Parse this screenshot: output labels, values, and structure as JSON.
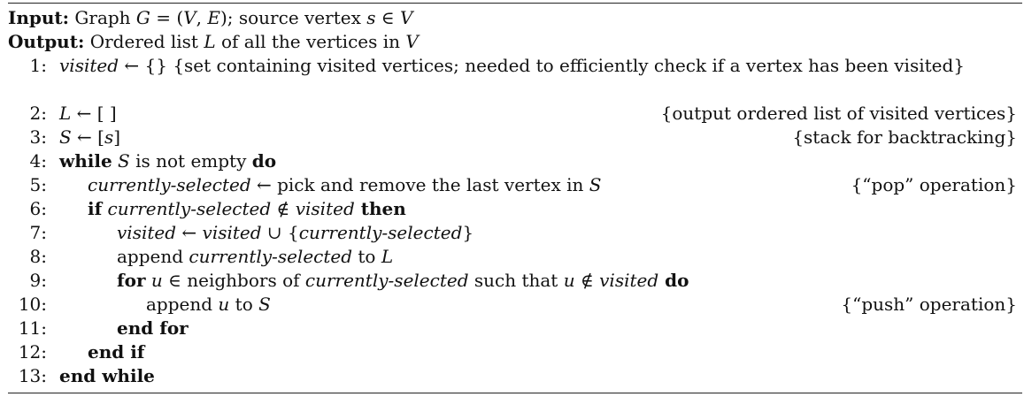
{
  "header": {
    "input_label": "Input:",
    "input_text_a": "Graph ",
    "input_G": "G",
    "input_eq": " = (",
    "input_V": "V",
    "input_comma": ", ",
    "input_E": "E",
    "input_close": ");  source vertex ",
    "input_s": "s",
    "input_in": " ∈ ",
    "input_V2": "V",
    "output_label": "Output:",
    "output_text_a": "Ordered list ",
    "output_L": "L",
    "output_text_b": " of all the vertices in ",
    "output_V": "V"
  },
  "lines": {
    "l1": {
      "num": "1:",
      "var": "visited",
      "op": " ← {}   ",
      "comment": "{set containing visited vertices; needed to efficiently check if a vertex has been visited}"
    },
    "l2": {
      "num": "2:",
      "var": "L",
      "op": " ← [ ]",
      "comment": "{output ordered list of visited vertices}"
    },
    "l3": {
      "num": "3:",
      "var": "S",
      "op": " ← [",
      "arg": "s",
      "close": "]",
      "comment": "{stack for backtracking}"
    },
    "l4": {
      "num": "4:",
      "kw1": "while",
      "var": " S",
      "text": " is not empty ",
      "kw2": "do"
    },
    "l5": {
      "num": "5:",
      "var": "currently-selected",
      "text": " ← pick and remove the last vertex in ",
      "var2": "S",
      "comment": "{“pop” operation}"
    },
    "l6": {
      "num": "6:",
      "kw1": "if",
      "var": " currently-selected",
      "op": " ∉ ",
      "var2": "visited",
      "kw2": " then"
    },
    "l7": {
      "num": "7:",
      "var": "visited",
      "op": " ← ",
      "var2": "visited",
      "op2": " ∪ {",
      "var3": "currently-selected",
      "close": "}"
    },
    "l8": {
      "num": "8:",
      "text": "append ",
      "var": "currently-selected",
      "text2": " to ",
      "var2": "L"
    },
    "l9": {
      "num": "9:",
      "kw1": "for",
      "var": " u",
      "text": " ∈ neighbors of ",
      "var2": "currently-selected",
      "text2": " such that ",
      "var3": "u",
      "op": " ∉ ",
      "var4": "visited",
      "kw2": " do"
    },
    "l10": {
      "num": "10:",
      "text": "append ",
      "var": "u",
      "text2": " to ",
      "var2": "S",
      "comment": "{“push” operation}"
    },
    "l11": {
      "num": "11:",
      "kw": "end for"
    },
    "l12": {
      "num": "12:",
      "kw": "end if"
    },
    "l13": {
      "num": "13:",
      "kw": "end while"
    }
  }
}
